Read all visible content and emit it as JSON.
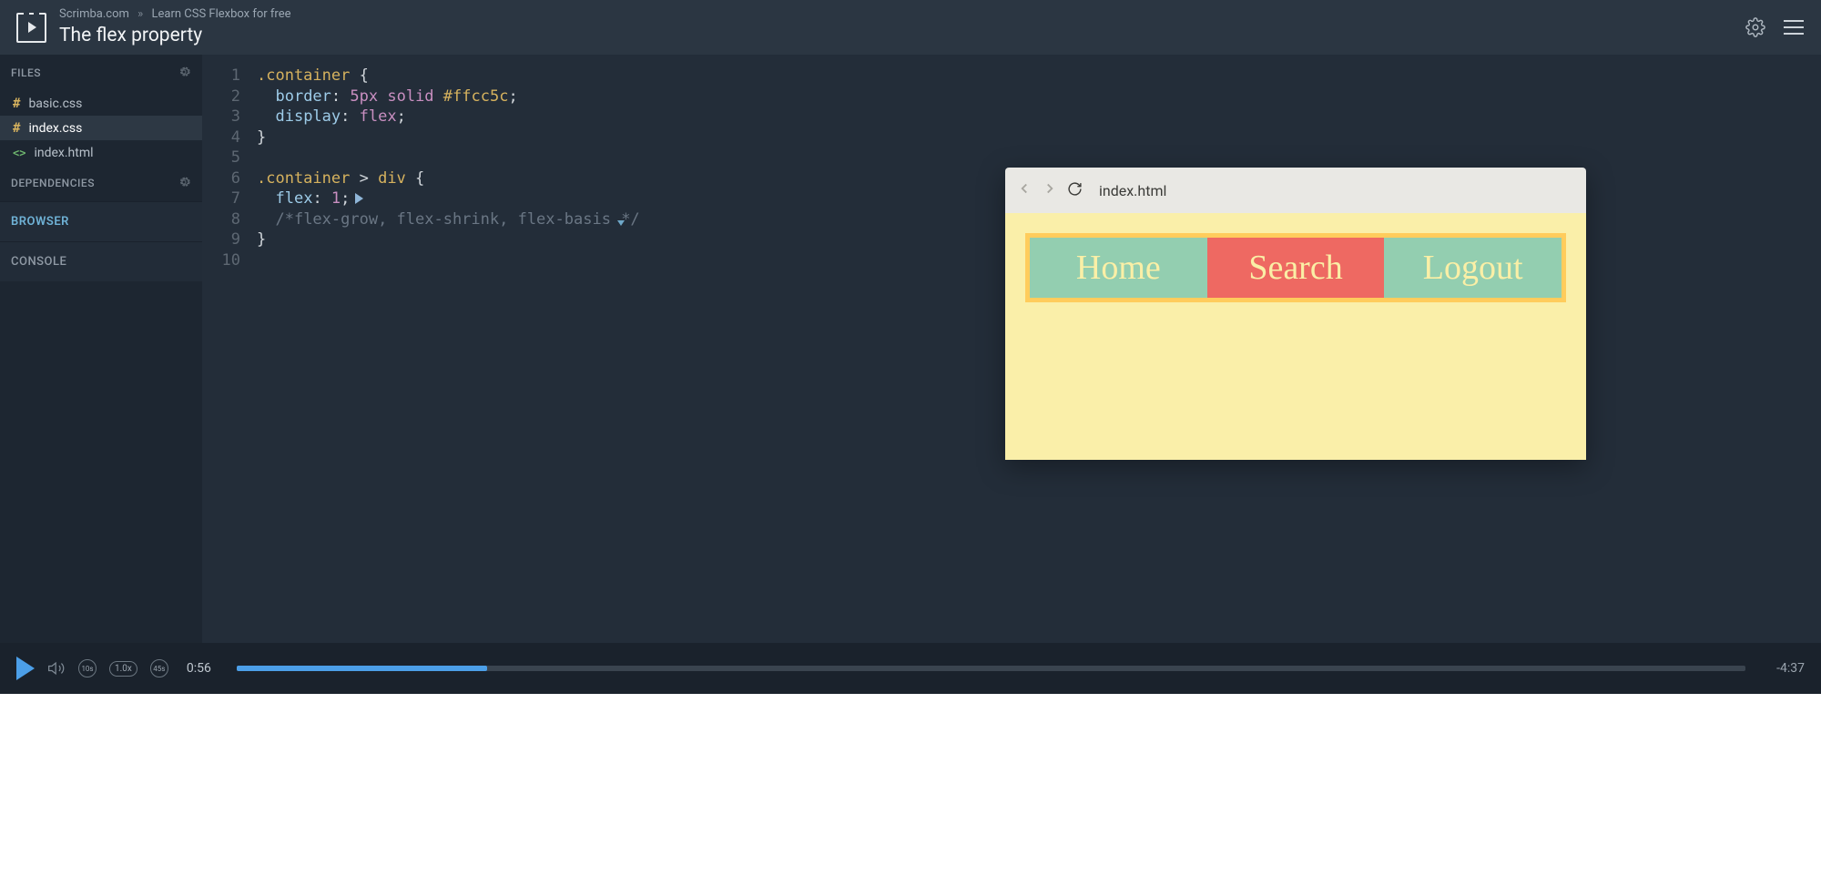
{
  "header": {
    "breadcrumb_site": "Scrimba.com",
    "breadcrumb_course": "Learn CSS Flexbox for free",
    "lesson_title": "The flex property"
  },
  "sidebar": {
    "files_label": "FILES",
    "dependencies_label": "DEPENDENCIES",
    "browser_label": "BROWSER",
    "console_label": "CONSOLE",
    "files": [
      {
        "name": "basic.css",
        "type": "css",
        "active": false
      },
      {
        "name": "index.css",
        "type": "css",
        "active": true
      },
      {
        "name": "index.html",
        "type": "html",
        "active": false
      }
    ]
  },
  "editor": {
    "lines": [
      {
        "n": "1",
        "segments": [
          {
            "t": ".container ",
            "c": "tok-sel"
          },
          {
            "t": "{",
            "c": "tok-punc"
          }
        ]
      },
      {
        "n": "2",
        "segments": [
          {
            "t": "  ",
            "c": ""
          },
          {
            "t": "border",
            "c": "tok-prop"
          },
          {
            "t": ": ",
            "c": "tok-punc"
          },
          {
            "t": "5px",
            "c": "tok-num"
          },
          {
            "t": " ",
            "c": ""
          },
          {
            "t": "solid",
            "c": "tok-kw"
          },
          {
            "t": " ",
            "c": ""
          },
          {
            "t": "#ffcc5c",
            "c": "tok-val"
          },
          {
            "t": ";",
            "c": "tok-punc"
          }
        ]
      },
      {
        "n": "3",
        "segments": [
          {
            "t": "  ",
            "c": ""
          },
          {
            "t": "display",
            "c": "tok-prop"
          },
          {
            "t": ": ",
            "c": "tok-punc"
          },
          {
            "t": "flex",
            "c": "tok-kw"
          },
          {
            "t": ";",
            "c": "tok-punc"
          }
        ]
      },
      {
        "n": "4",
        "segments": [
          {
            "t": "}",
            "c": "tok-punc"
          }
        ]
      },
      {
        "n": "5",
        "segments": []
      },
      {
        "n": "6",
        "segments": [
          {
            "t": ".container ",
            "c": "tok-sel"
          },
          {
            "t": "> ",
            "c": "tok-punc"
          },
          {
            "t": "div ",
            "c": "tok-sel"
          },
          {
            "t": "{",
            "c": "tok-punc"
          }
        ]
      },
      {
        "n": "7",
        "segments": [
          {
            "t": "  ",
            "c": ""
          },
          {
            "t": "flex",
            "c": "tok-prop"
          },
          {
            "t": ": ",
            "c": "tok-punc"
          },
          {
            "t": "1",
            "c": "tok-num"
          },
          {
            "t": ";",
            "c": "tok-punc"
          }
        ],
        "playcursor": true
      },
      {
        "n": "8",
        "segments": [
          {
            "t": "  ",
            "c": ""
          },
          {
            "t": "/*flex-grow, flex-shrink, flex-basis ",
            "c": "tok-comment"
          },
          {
            "t": "",
            "c": "",
            "caret": true
          },
          {
            "t": "*/",
            "c": "tok-comment"
          }
        ]
      },
      {
        "n": "9",
        "segments": [
          {
            "t": "}",
            "c": "tok-punc"
          }
        ]
      },
      {
        "n": "10",
        "segments": []
      }
    ]
  },
  "preview": {
    "url": "index.html",
    "items": [
      {
        "label": "Home",
        "cls": "home"
      },
      {
        "label": "Search",
        "cls": "search"
      },
      {
        "label": "Logout",
        "cls": "logout"
      }
    ]
  },
  "playbar": {
    "current_time": "0:56",
    "remaining_time": "-4:37",
    "speed": "1.0x",
    "skip_back": "10s",
    "skip_fwd": "45s",
    "progress_percent": 16.6
  }
}
